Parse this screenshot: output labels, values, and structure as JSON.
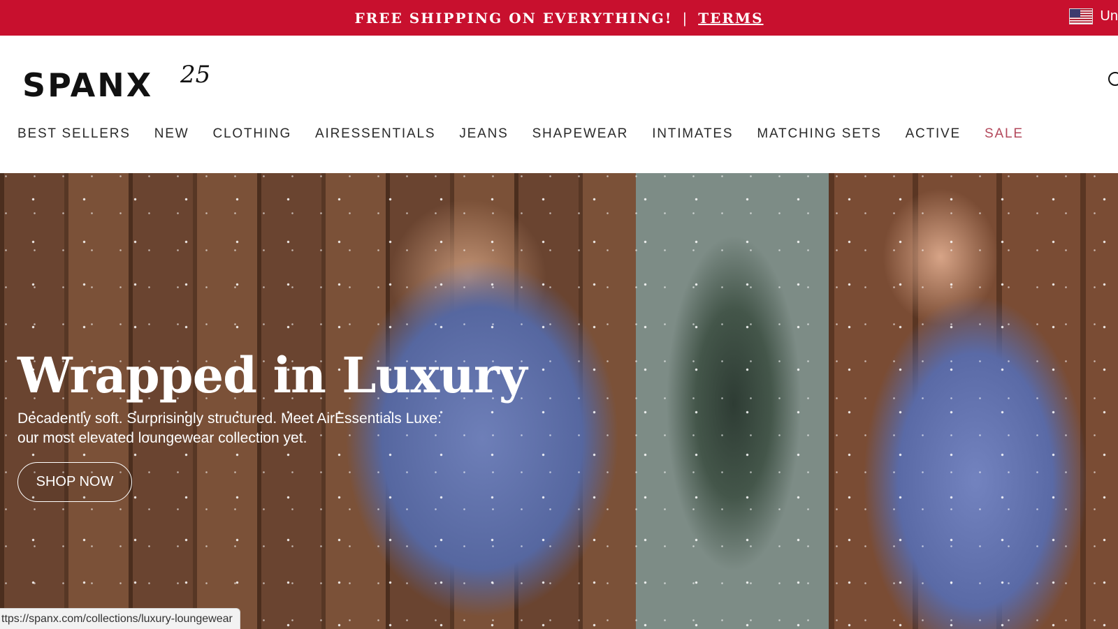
{
  "promo": {
    "message": "FREE SHIPPING ON EVERYTHING!",
    "separator": "|",
    "terms_link": "TERMS",
    "locale_label": "Un",
    "flag_icon": "us-flag-icon"
  },
  "header": {
    "logo_text": "SPANX",
    "logo_sup": "25",
    "search_icon": "search-icon"
  },
  "nav": {
    "items": [
      {
        "label": "BEST SELLERS"
      },
      {
        "label": "NEW"
      },
      {
        "label": "CLOTHING"
      },
      {
        "label": "AIRESSENTIALS"
      },
      {
        "label": "JEANS"
      },
      {
        "label": "SHAPEWEAR"
      },
      {
        "label": "INTIMATES"
      },
      {
        "label": "MATCHING SETS"
      },
      {
        "label": "ACTIVE"
      },
      {
        "label": "SALE"
      }
    ],
    "sale_color": "#b3495c"
  },
  "hero": {
    "title": "Wrapped in Luxury",
    "subtitle": "Decadently soft. Surprisingly structured. Meet AirEssentials Luxe: our most elevated loungewear collection yet.",
    "cta_label": "SHOP NOW"
  },
  "status_bar": {
    "url": "ttps://spanx.com/collections/luxury-loungewear"
  },
  "colors": {
    "promo_bg": "#c8102e",
    "text_dark": "#2a2a2a"
  }
}
